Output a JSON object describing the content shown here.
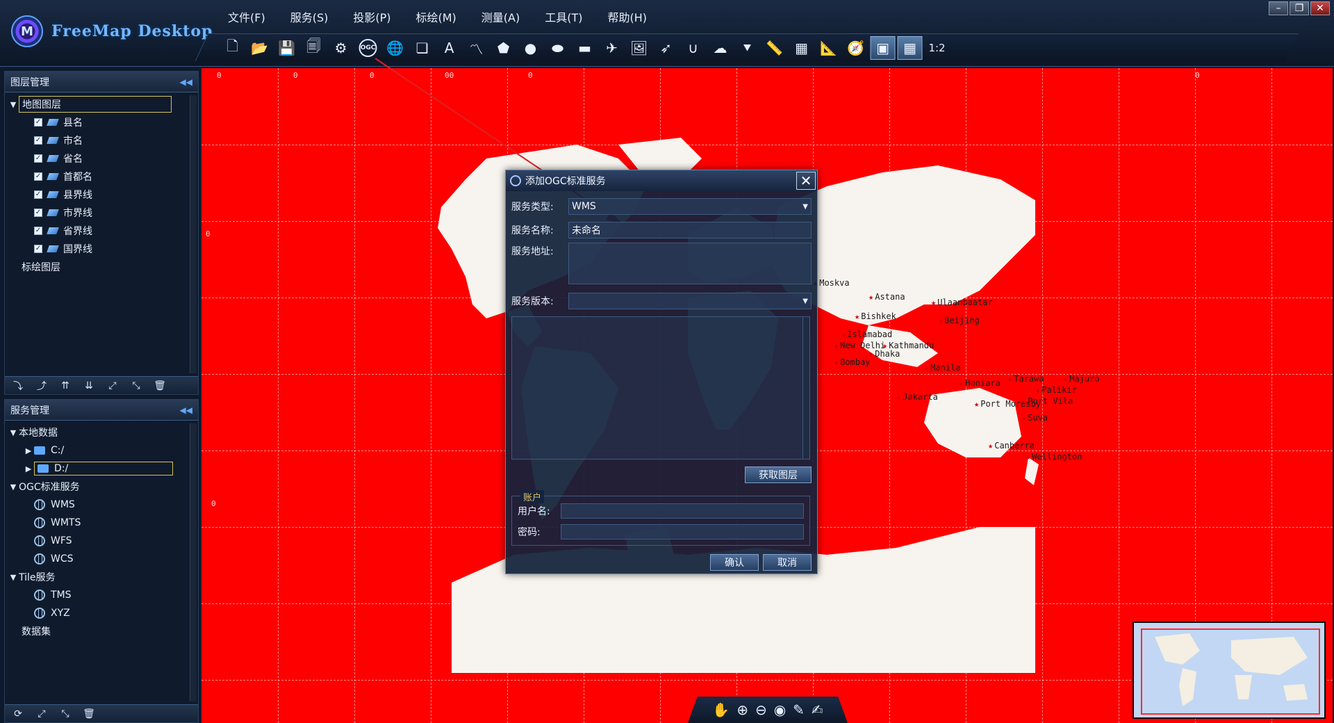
{
  "app": {
    "title": "FreeMap Desktop"
  },
  "menu": [
    "文件(F)",
    "服务(S)",
    "投影(P)",
    "标绘(M)",
    "测量(A)",
    "工具(T)",
    "帮助(H)"
  ],
  "toolbar": {
    "ogc_label": "OGC",
    "scale_label": "1:2"
  },
  "layer_panel": {
    "title": "图层管理",
    "root": "地图图层",
    "layers": [
      "县名",
      "市名",
      "省名",
      "首都名",
      "县界线",
      "市界线",
      "省界线",
      "国界线"
    ],
    "annotation_layer": "标绘图层"
  },
  "service_panel": {
    "title": "服务管理",
    "local": "本地数据",
    "drives": [
      "C:/",
      "D:/"
    ],
    "ogc": "OGC标准服务",
    "ogc_items": [
      "WMS",
      "WMTS",
      "WFS",
      "WCS"
    ],
    "tile": "Tile服务",
    "tile_items": [
      "TMS",
      "XYZ"
    ],
    "dataset": "数据集"
  },
  "map": {
    "grid_labels": [
      "0",
      "0",
      "0",
      "00",
      "0",
      "0",
      "0",
      "0"
    ],
    "cities": [
      "Astana",
      "Ulaanbaatar",
      "Bishkek",
      "Beijing",
      "Moskva",
      "Islamabad",
      "New Delhi",
      "Dhaka",
      "Bombay",
      "Kathmandu",
      "Manila",
      "Jakarta",
      "Port Moresby",
      "Canberra",
      "Wellington",
      "Suva",
      "Tarawa",
      "Majuro",
      "Palikir",
      "Honiara",
      "Port Vila"
    ]
  },
  "dialog": {
    "title": "添加OGC标准服务",
    "service_type_label": "服务类型:",
    "service_type_value": "WMS",
    "service_name_label": "服务名称:",
    "service_name_value": "未命名",
    "service_url_label": "服务地址:",
    "service_version_label": "服务版本:",
    "get_layers_button": "获取图层",
    "account_legend": "账户",
    "username_label": "用户名:",
    "password_label": "密码:",
    "ok_button": "确认",
    "cancel_button": "取消"
  },
  "colors": {
    "map_background": "#ff0000",
    "land": "#f7f4ef",
    "accent": "#5aa2ff"
  }
}
